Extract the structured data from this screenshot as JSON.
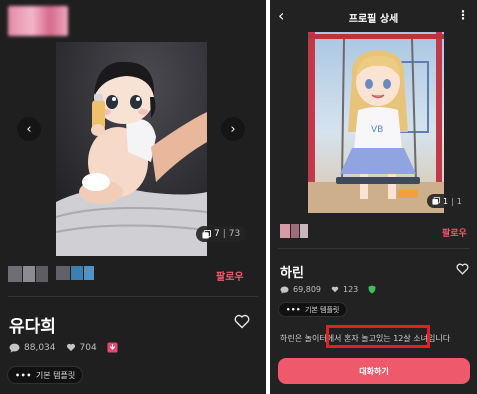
{
  "left": {
    "image_count": {
      "current": "7",
      "separator": "|",
      "total": "73"
    },
    "follow_label": "팔로우",
    "name": "유다희",
    "stats": {
      "chats": "88,034",
      "likes": "704"
    },
    "tag_label": "기본 템플릿",
    "tag_dots": "•••"
  },
  "right": {
    "header": {
      "back_icon": "‹",
      "title": "프로필 상세",
      "more_icon": "⋮"
    },
    "image_count": {
      "current": "1",
      "separator": "|",
      "total": "1"
    },
    "follow_label": "팔로우",
    "name": "하린",
    "stats": {
      "chats": "69,809",
      "likes": "123"
    },
    "tag_label": "기본 템플릿",
    "tag_dots": "•••",
    "description": "하린은 놀이터에서 혼자 놀고있는 12살 소녀입니다",
    "chat_button": "대화하기"
  },
  "icons": {
    "prev": "‹",
    "next": "›"
  },
  "colors": {
    "background": "#1f1f1f",
    "accent": "#ee5a6c",
    "highlight_box": "#e21f25"
  }
}
